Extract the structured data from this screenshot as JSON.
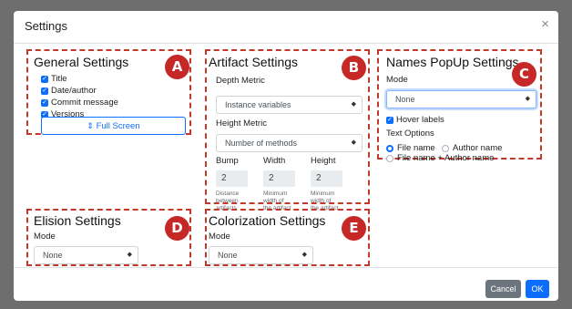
{
  "dialog": {
    "title": "Settings",
    "close": "×"
  },
  "panels": {
    "general": {
      "title": "General Settings",
      "badge": "A",
      "checks": [
        "Title",
        "Date/author",
        "Commit message",
        "Versions"
      ],
      "fullscreen_label": "Full Screen"
    },
    "artifact": {
      "title": "Artifact Settings",
      "badge": "B",
      "depth_label": "Depth Metric",
      "depth_value": "Instance variables",
      "height_label": "Height Metric",
      "height_value": "Number of methods",
      "cols": [
        {
          "label": "Bump",
          "value": "2",
          "desc": [
            "Distance",
            "between",
            "artifacts"
          ]
        },
        {
          "label": "Width",
          "value": "2",
          "desc": [
            "Minimum",
            "width of",
            "the artifact"
          ]
        },
        {
          "label": "Height",
          "value": "2",
          "desc": [
            "Minimum",
            "width of",
            "the artifact"
          ]
        }
      ]
    },
    "names": {
      "title": "Names PopUp Settings",
      "badge": "C",
      "mode_label": "Mode",
      "mode_value": "None",
      "hover_label": "Hover labels",
      "text_options_label": "Text Options",
      "radio_file": "File name",
      "radio_author": "Author name",
      "radio_both": "File name + Author name"
    },
    "elision": {
      "title": "Elision Settings",
      "badge": "D",
      "mode_label": "Mode",
      "mode_value": "None"
    },
    "colorization": {
      "title": "Colorization Settings",
      "badge": "E",
      "mode_label": "Mode",
      "mode_value": "None"
    }
  },
  "footer": {
    "cancel": "Cancel",
    "ok": "OK"
  },
  "colors": {
    "accent": "#0d6efd",
    "badge": "#c62828",
    "dash": "#c0392b"
  }
}
